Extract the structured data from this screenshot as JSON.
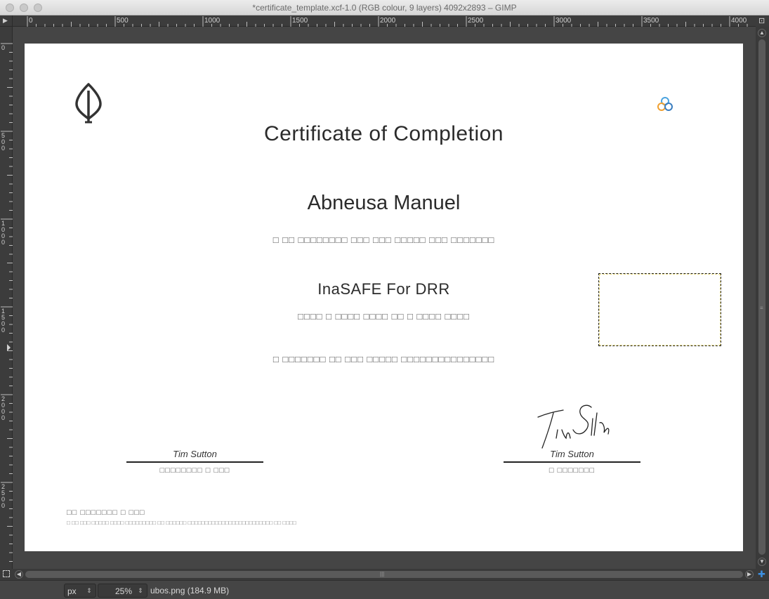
{
  "window": {
    "title": "*certificate_template.xcf-1.0 (RGB colour, 9 layers) 4092x2893 – GIMP"
  },
  "rulers": {
    "corner_glyph": "▶",
    "nav_glyph": "⊡",
    "horizontal_labels": [
      "0",
      "500",
      "1000",
      "1500",
      "2000",
      "2500",
      "3000",
      "3500",
      "4000"
    ],
    "vertical_labels": [
      "0",
      "500",
      "1000",
      "1500",
      "2000",
      "2500"
    ]
  },
  "certificate": {
    "title": "Certificate of Completion",
    "recipient": "Abneusa Manuel",
    "line1": "□ □□ □□□□□□□□ □□□ □□□ □□□□□ □□□ □□□□□□□",
    "course": "InaSAFE For DRR",
    "line2": "□□□□  □ □□□□ □□□□ □□ □ □□□□ □□□□",
    "line3": "□ □□□□□□□ □□ □□□  □□□□□ □□□□□□□□□□□□□□□",
    "signatory_left": {
      "name": "Tim Sutton",
      "role": "□□□□□□□□ □ □□□"
    },
    "signatory_right": {
      "name": "Tim Sutton",
      "role": "□ □□□□□□□"
    },
    "footer_title": "□□ □□□□□□□ □ □□□",
    "footer_text": "□ □□ □□□ □□□□□ □□□□ □□□□□□□□□ □□ □□□□□□ □□□□□□□□□□□□□□□□□□□□□□□□□ □□ □□□□"
  },
  "scrollbars": {
    "up_arrow": "▲",
    "down_arrow": "▼",
    "left_arrow": "◀",
    "right_arrow": "▶",
    "v_grip": "≡",
    "h_grip": "|||"
  },
  "statusbar": {
    "unit": "px",
    "zoom": "25%",
    "spin_glyph": "⇕",
    "status": "ubos.png (184.9 MB)"
  },
  "colors": {
    "canvas_bg": "#454545",
    "page_bg": "#ffffff",
    "logo_dark": "#333333",
    "logo_blue": "#4aa3df",
    "logo_orange": "#f0a030",
    "selection_yellow": "#e8d97a",
    "nav_blue": "#3d8fe0"
  }
}
